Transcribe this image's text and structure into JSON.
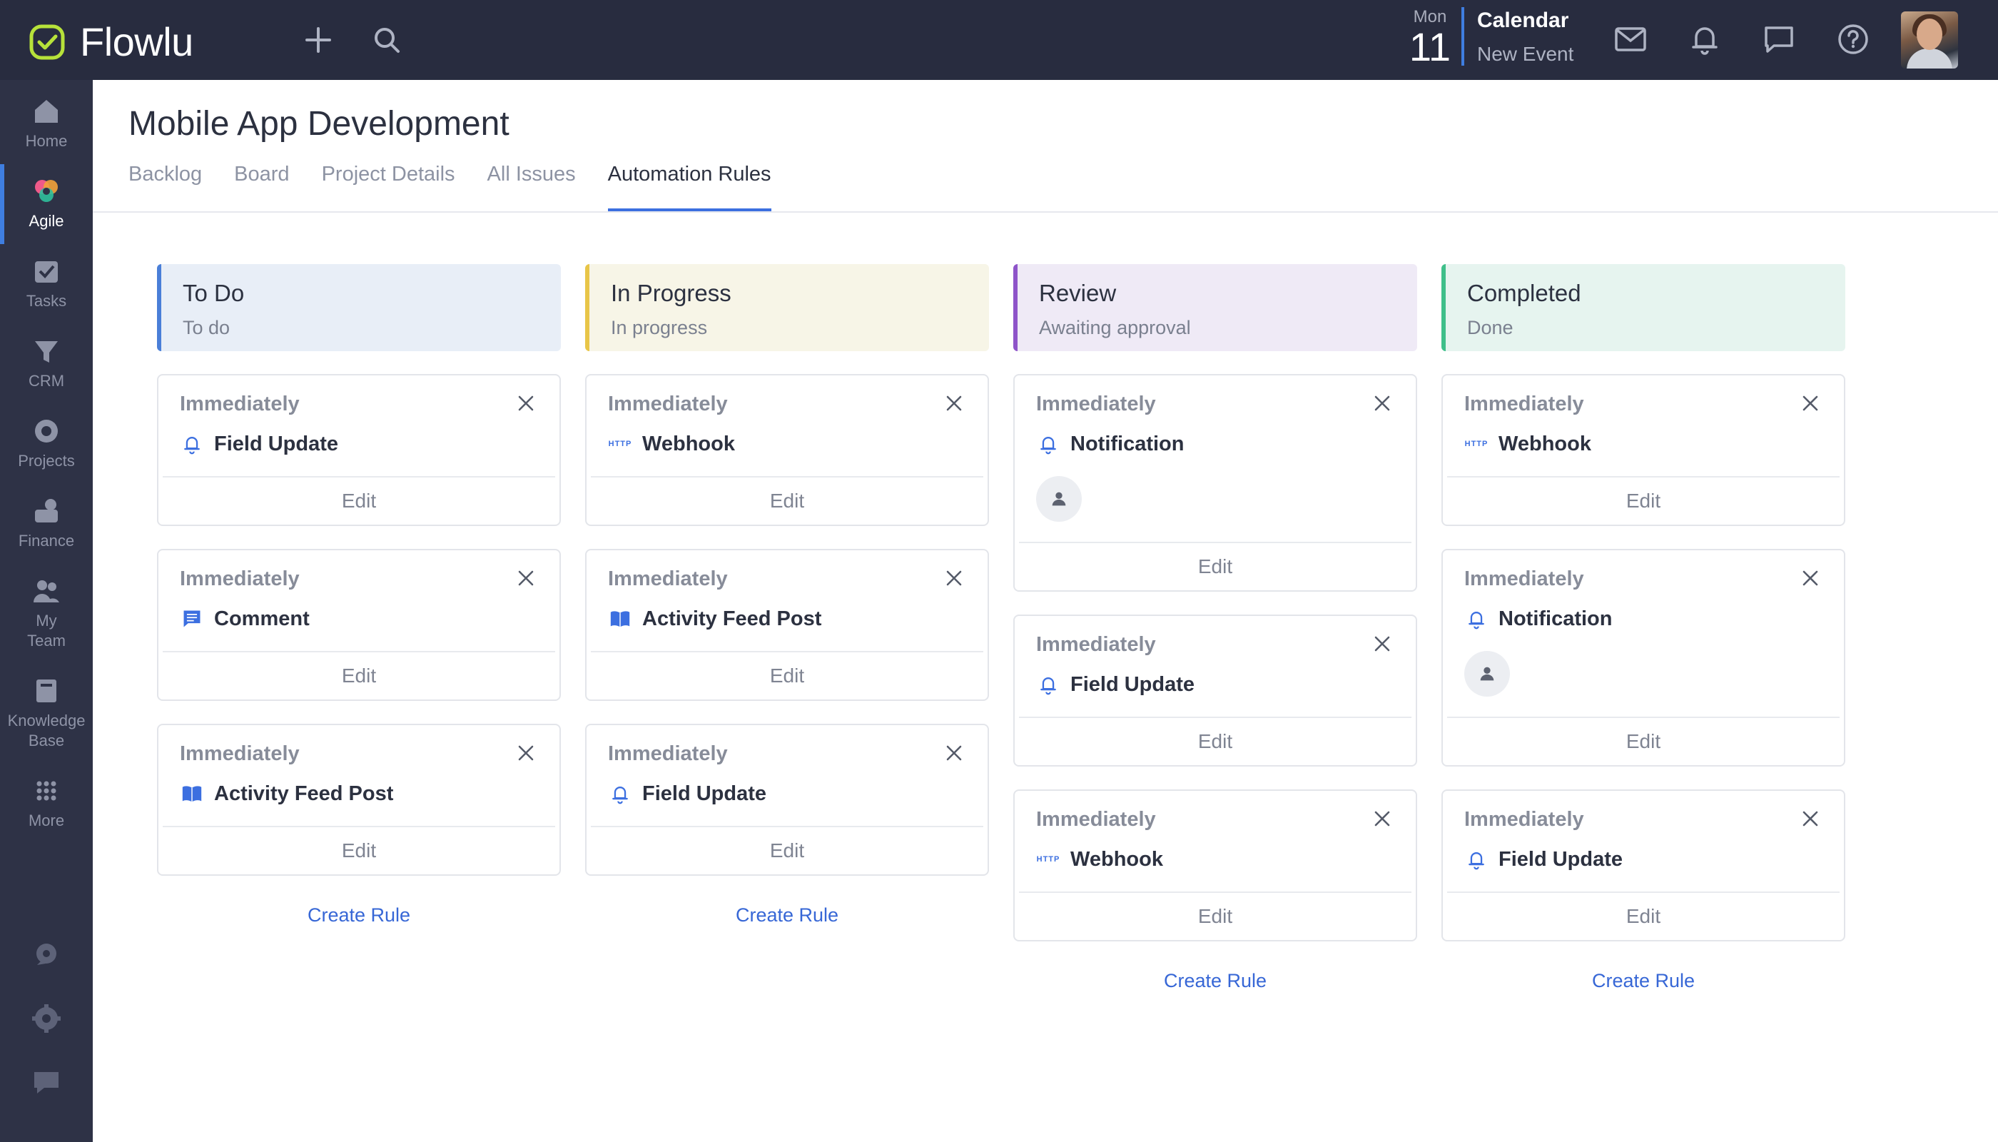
{
  "app": {
    "name": "Flowlu"
  },
  "topbar": {
    "date_dow": "Mon",
    "date_day": "11",
    "calendar_title": "Calendar",
    "calendar_sub": "New Event",
    "icons": [
      "plus-icon",
      "search-icon",
      "mail-icon",
      "bell-icon",
      "chat-icon",
      "help-icon"
    ]
  },
  "sidebar": {
    "items": [
      {
        "label": "Home",
        "icon": "home-icon"
      },
      {
        "label": "Agile",
        "icon": "agile-icon"
      },
      {
        "label": "Tasks",
        "icon": "tasks-icon"
      },
      {
        "label": "CRM",
        "icon": "crm-icon"
      },
      {
        "label": "Projects",
        "icon": "projects-icon"
      },
      {
        "label": "Finance",
        "icon": "finance-icon"
      },
      {
        "label": "My Team",
        "icon": "team-icon"
      },
      {
        "label": "Knowledge Base",
        "icon": "knowledge-icon"
      },
      {
        "label": "More",
        "icon": "grid-icon"
      }
    ],
    "bottom_icons": [
      "rocket-icon",
      "settings-icon",
      "support-icon"
    ]
  },
  "page": {
    "title": "Mobile App Development",
    "tabs": [
      {
        "label": "Backlog"
      },
      {
        "label": "Board"
      },
      {
        "label": "Project Details"
      },
      {
        "label": "All Issues"
      },
      {
        "label": "Automation Rules"
      }
    ],
    "active_tab": "Automation Rules"
  },
  "columns": [
    {
      "title": "To Do",
      "sub": "To do",
      "accent": "#4a7fd8",
      "bg": "#e8eef7",
      "create_label": "Create Rule",
      "rules": [
        {
          "when": "Immediately",
          "action": "Field Update",
          "icon": "bell-icon",
          "edit": "Edit"
        },
        {
          "when": "Immediately",
          "action": "Comment",
          "icon": "comment-icon",
          "edit": "Edit"
        },
        {
          "when": "Immediately",
          "action": "Activity Feed Post",
          "icon": "book-icon",
          "edit": "Edit"
        }
      ]
    },
    {
      "title": "In Progress",
      "sub": "In progress",
      "accent": "#e8c548",
      "bg": "#f7f5e7",
      "create_label": "Create Rule",
      "rules": [
        {
          "when": "Immediately",
          "action": "Webhook",
          "icon": "http-icon",
          "edit": "Edit"
        },
        {
          "when": "Immediately",
          "action": "Activity Feed Post",
          "icon": "book-icon",
          "edit": "Edit"
        },
        {
          "when": "Immediately",
          "action": "Field Update",
          "icon": "bell-icon",
          "edit": "Edit"
        }
      ]
    },
    {
      "title": "Review",
      "sub": "Awaiting approval",
      "accent": "#8e54c9",
      "bg": "#efeaf6",
      "create_label": "Create Rule",
      "rules": [
        {
          "when": "Immediately",
          "action": "Notification",
          "icon": "bell-icon",
          "edit": "Edit",
          "user": true
        },
        {
          "when": "Immediately",
          "action": "Field Update",
          "icon": "bell-icon",
          "edit": "Edit"
        },
        {
          "when": "Immediately",
          "action": "Webhook",
          "icon": "http-icon",
          "edit": "Edit"
        }
      ]
    },
    {
      "title": "Completed",
      "sub": "Done",
      "accent": "#3fbf8a",
      "bg": "#e6f4ef",
      "create_label": "Create Rule",
      "rules": [
        {
          "when": "Immediately",
          "action": "Webhook",
          "icon": "http-icon",
          "edit": "Edit"
        },
        {
          "when": "Immediately",
          "action": "Notification",
          "icon": "bell-icon",
          "edit": "Edit",
          "user": true
        },
        {
          "when": "Immediately",
          "action": "Field Update",
          "icon": "bell-icon",
          "edit": "Edit"
        }
      ]
    }
  ]
}
